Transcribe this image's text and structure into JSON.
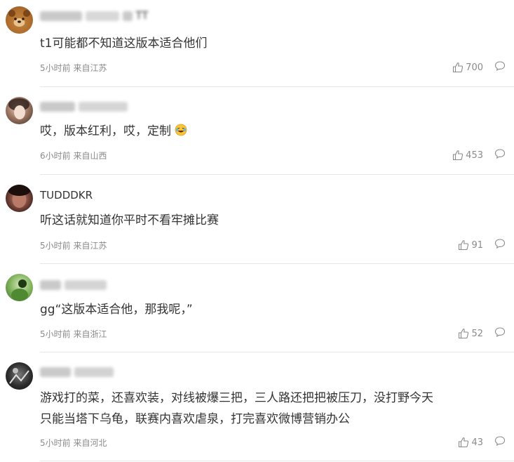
{
  "comments": [
    {
      "username": "",
      "text": "t1可能都不知道这版本适合他们",
      "meta": "5小时前 来自江苏",
      "likes": "700",
      "avatar_icon": "bear-avatar"
    },
    {
      "username": "",
      "text": "哎，版本红利，哎，定制",
      "meta": "6小时前 来自山西",
      "likes": "453",
      "avatar_icon": "portrait-avatar"
    },
    {
      "username": "TUDDDKR",
      "text": "听这话就知道你平时不看牢摊比赛",
      "meta": "5小时前 来自江苏",
      "likes": "91",
      "avatar_icon": "portrait-avatar"
    },
    {
      "username": "",
      "text": "gg“这版本适合他，那我呢，”",
      "meta": "5小时前 来自浙江",
      "likes": "52",
      "avatar_icon": "green-avatar"
    },
    {
      "username": "",
      "text_lines": [
        "游戏打的菜，还喜欢装，对线被爆三把，三人路还把把被压刀，没打野今天",
        "只能当塔下乌龟，联赛内喜欢虐泉，打完喜欢微博营销办公"
      ],
      "meta": "5小时前 来自河北",
      "likes": "43",
      "avatar_icon": "dark-avatar"
    }
  ],
  "colors": {
    "text": "#333333",
    "meta": "#8a8a8a",
    "divider": "#e6e6e6"
  }
}
